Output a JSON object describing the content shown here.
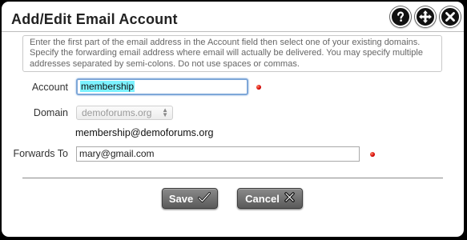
{
  "dialog": {
    "title": "Add/Edit Email Account",
    "header_icons": [
      "help-icon",
      "move-icon",
      "close-icon"
    ]
  },
  "help_text": "Enter the first part of the email address in the Account field then select one of your existing domains. Specify the forwarding email address where email will actually be delivered. You may specify multiple addresses separated by semi-colons. Do not use spaces or commas.",
  "form": {
    "account_label": "Account",
    "account_value": "membership",
    "domain_label": "Domain",
    "domain_value": "demoforums.org",
    "full_address": "membership@demoforums.org",
    "forwards_label": "Forwards To",
    "forwards_value": "mary@gmail.com"
  },
  "buttons": {
    "save": "Save",
    "cancel": "Cancel"
  },
  "colors": {
    "required_dot": "#d40000",
    "selection_highlight": "#7cf2ff",
    "button_bg": "#6e6e6e"
  }
}
